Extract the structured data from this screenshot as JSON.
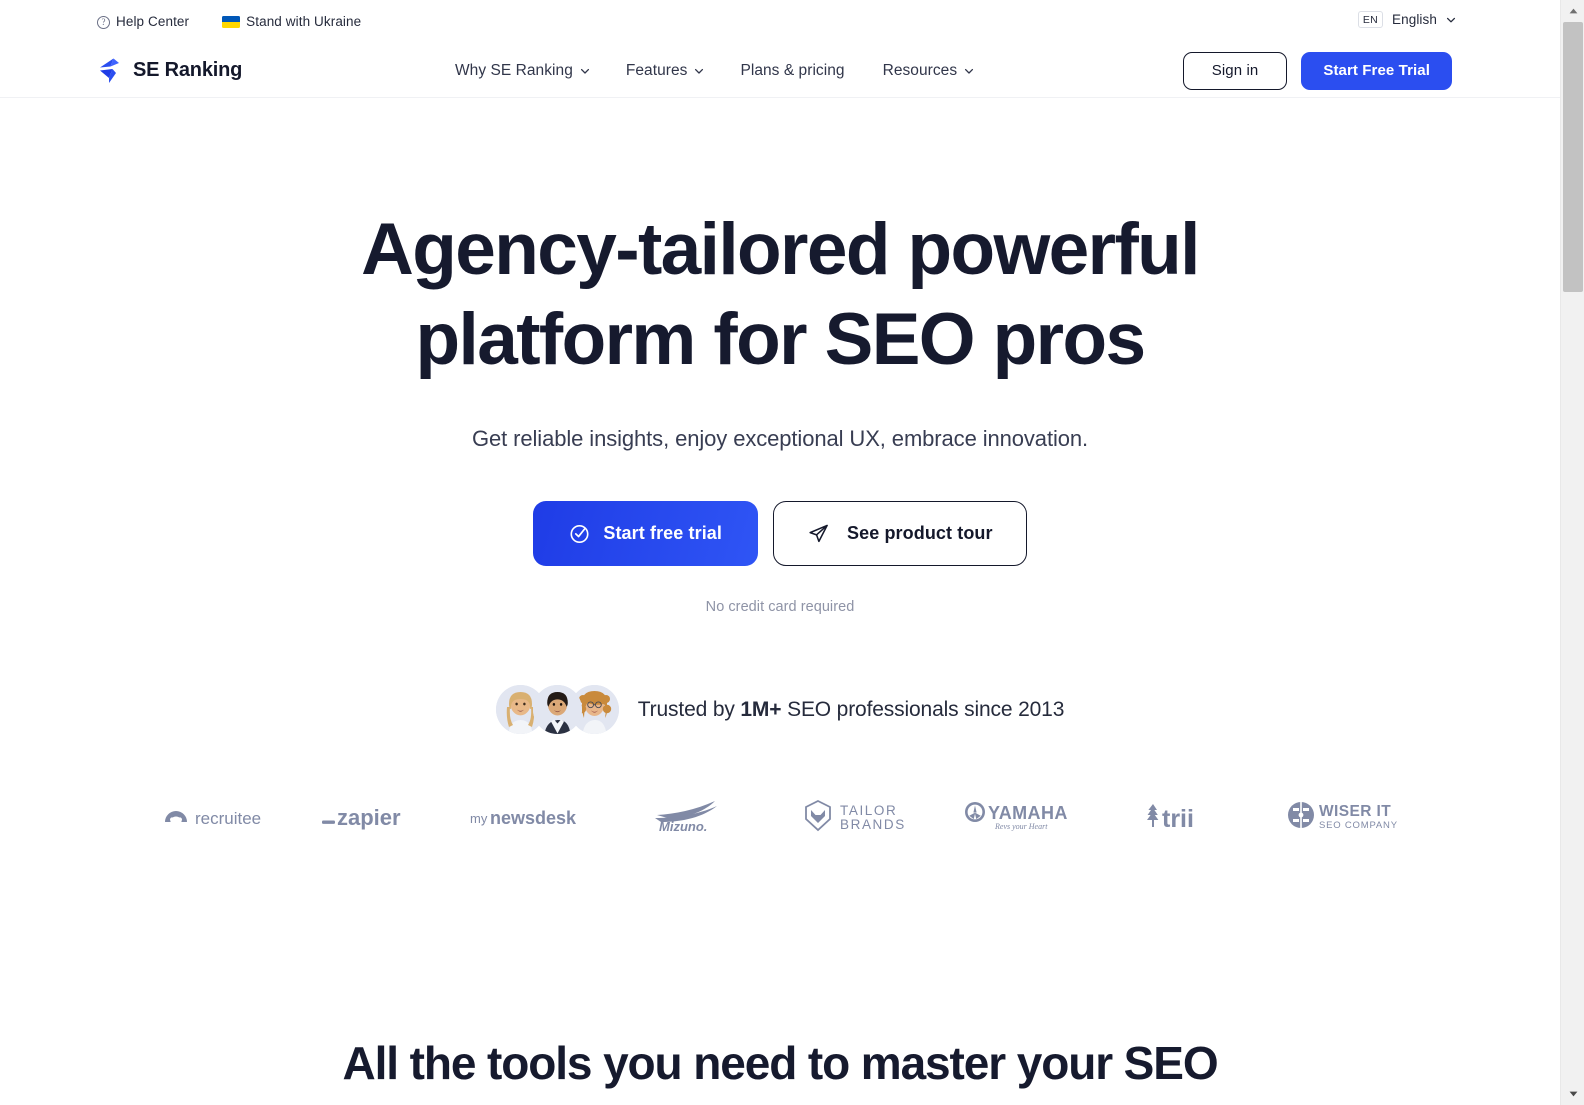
{
  "utility": {
    "help_center": "Help Center",
    "help_icon": "question-circle-icon",
    "ukraine": "Stand with Ukraine",
    "ukraine_icon": "ukraine-flag-icon",
    "lang_code": "EN",
    "lang_name": "English",
    "lang_caret_icon": "chevron-down-icon"
  },
  "header": {
    "brand": "SE Ranking",
    "brand_icon": "se-ranking-lightning-logo",
    "nav": [
      {
        "label": "Why SE Ranking",
        "has_caret": true
      },
      {
        "label": "Features",
        "has_caret": true
      },
      {
        "label": "Plans & pricing",
        "has_caret": false
      },
      {
        "label": "Resources",
        "has_caret": true
      }
    ],
    "sign_in": "Sign in",
    "start_free_trial": "Start Free Trial"
  },
  "hero": {
    "title_line1": "Agency-tailored powerful",
    "title_line2": "platform for SEO pros",
    "subtitle": "Get reliable insights, enjoy exceptional UX, embrace innovation.",
    "cta_primary": "Start free trial",
    "cta_primary_icon": "check-circle-icon",
    "cta_secondary": "See product tour",
    "cta_secondary_icon": "paper-plane-icon",
    "note": "No credit card required"
  },
  "trusted": {
    "prefix": "Trusted by ",
    "count": "1M+",
    "suffix": " SEO professionals since 2013",
    "avatars": [
      "avatar-woman-blonde",
      "avatar-man-dark-hair",
      "avatar-woman-curly-glasses"
    ]
  },
  "logos": [
    {
      "name": "recruitee",
      "label": "recruitee"
    },
    {
      "name": "zapier",
      "label": "_zapier"
    },
    {
      "name": "mynewsdesk",
      "label": "mynewsdesk"
    },
    {
      "name": "mizuno",
      "label": "Mizuno"
    },
    {
      "name": "tailor-brands",
      "label": "TAILOR BRANDS"
    },
    {
      "name": "yamaha",
      "label": "YAMAHA"
    },
    {
      "name": "trii",
      "label": "trii"
    },
    {
      "name": "wiser-it",
      "label": "WISER IT SEO COMPANY"
    }
  ],
  "section": {
    "title": "All the tools you need to master your SEO"
  },
  "colors": {
    "accent_blue": "#2b4ef0",
    "ink": "#161a2e",
    "muted": "#8e93a6",
    "logo_gray": "#818aa6"
  }
}
